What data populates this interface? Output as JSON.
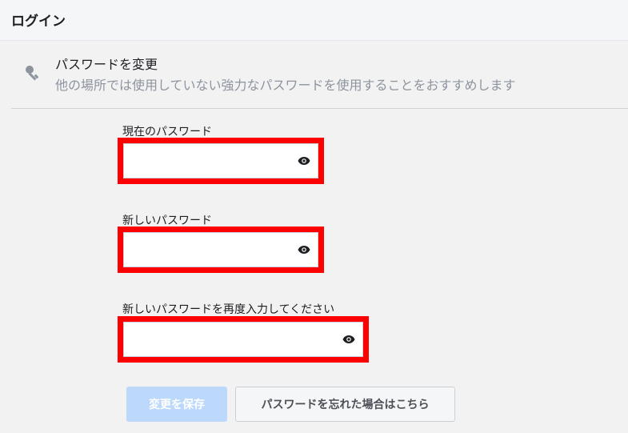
{
  "header": {
    "title": "ログイン"
  },
  "section": {
    "icon": "key-icon",
    "title": "パスワードを変更",
    "description": "他の場所では使用していない強力なパスワードを使用することをおすすめします"
  },
  "fields": [
    {
      "label": "現在のパスワード",
      "value": "",
      "icon": "eye-icon"
    },
    {
      "label": "新しいパスワード",
      "value": "",
      "icon": "eye-icon"
    },
    {
      "label": "新しいパスワードを再度入力してください",
      "value": "",
      "icon": "eye-icon"
    }
  ],
  "buttons": {
    "save_label": "変更を保存",
    "forgot_label": "パスワードを忘れた場合はこちら"
  },
  "colors": {
    "highlight": "#ff0000",
    "save_button_disabled": "#bcd8fb"
  }
}
